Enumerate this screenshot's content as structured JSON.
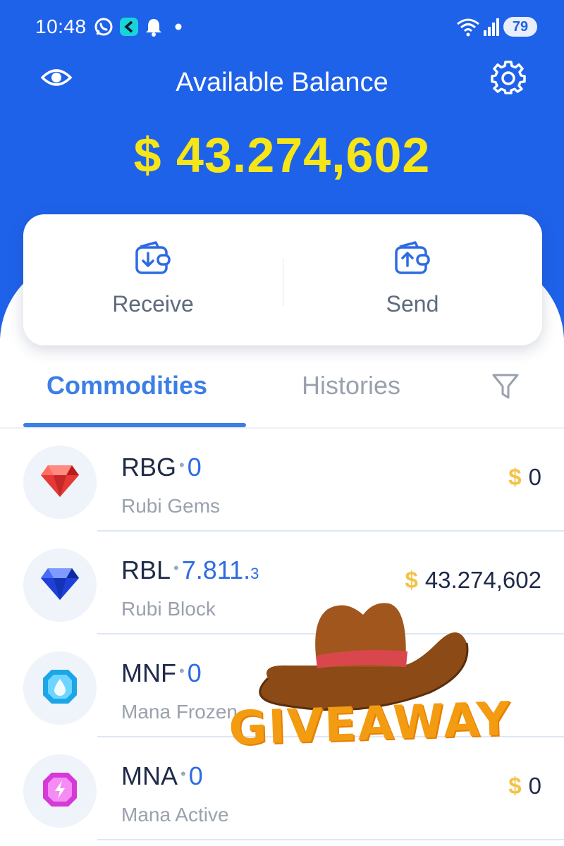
{
  "status_bar": {
    "time": "10:48",
    "battery": "79",
    "icons": [
      "whatsapp-icon",
      "app-icon",
      "bell-icon",
      "dot-icon",
      "wifi-icon",
      "signal-icon",
      "battery-icon"
    ]
  },
  "header": {
    "title": "Available Balance",
    "balance": "$ 43.274,602",
    "visibility_icon": "eye-icon",
    "settings_icon": "gear-icon"
  },
  "actions": {
    "receive": {
      "label": "Receive",
      "icon": "wallet-receive-icon"
    },
    "send": {
      "label": "Send",
      "icon": "wallet-send-icon"
    }
  },
  "tabs": [
    {
      "label": "Commodities",
      "active": true
    },
    {
      "label": "Histories",
      "active": false
    }
  ],
  "filter_icon": "filter-icon",
  "commodities": [
    {
      "ticker": "RBG",
      "amount": "0",
      "amount_sub": "",
      "name": "Rubi Gems",
      "currency": "$",
      "value": "0",
      "icon": "red-gem-icon"
    },
    {
      "ticker": "RBL",
      "amount": "7.811.",
      "amount_sub": "3",
      "name": "Rubi Block",
      "currency": "$",
      "value": "43.274,602",
      "icon": "blue-gem-icon"
    },
    {
      "ticker": "MNF",
      "amount": "0",
      "amount_sub": "",
      "name": "Mana Frozen",
      "currency": "",
      "value": "",
      "icon": "mana-frozen-icon"
    },
    {
      "ticker": "MNA",
      "amount": "0",
      "amount_sub": "",
      "name": "Mana Active",
      "currency": "$",
      "value": "0",
      "icon": "mana-active-icon"
    }
  ],
  "overlay": {
    "text": "GIVEAWAY",
    "icon": "cowboy-hat-icon"
  },
  "colors": {
    "header_blue": "#1f62ea",
    "balance_yellow": "#f6e617",
    "accent_blue": "#3b7fe6",
    "currency_gold": "#f4c247"
  }
}
